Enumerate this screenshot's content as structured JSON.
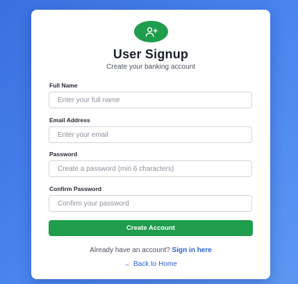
{
  "header": {
    "icon": "user-plus-icon",
    "title": "User Signup",
    "subtitle": "Create your banking account"
  },
  "form": {
    "full_name": {
      "label": "Full Name",
      "value": "",
      "placeholder": "Enter your full name"
    },
    "email": {
      "label": "Email Address",
      "value": "",
      "placeholder": "Enter your email"
    },
    "password": {
      "label": "Password",
      "value": "",
      "placeholder": "Create a password (min 6 characters)"
    },
    "confirm_password": {
      "label": "Confirm Password",
      "value": "",
      "placeholder": "Confirm your password"
    },
    "submit_label": "Create Account"
  },
  "footer": {
    "have_account_text": "Already have an account?",
    "signin_link": "Sign in here",
    "back_link": "← Back to Home"
  },
  "colors": {
    "background_gradient": [
      "#3a6fe0",
      "#5d96f2"
    ],
    "accent_green": "#1f9d4c",
    "link_blue": "#2b5fd1"
  }
}
